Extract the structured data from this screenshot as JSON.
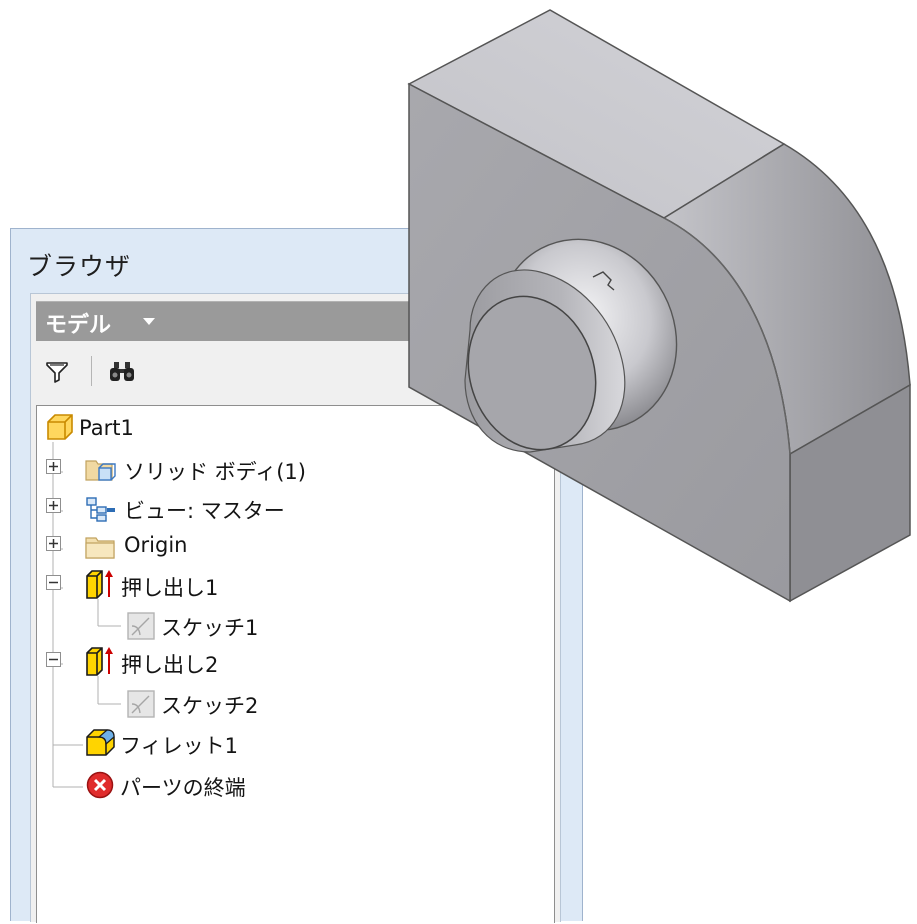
{
  "browser": {
    "title": "ブラウザ",
    "model_selector": {
      "label": "モデル"
    },
    "toolbar": {
      "filter_icon": "filter-icon",
      "find_icon": "binoculars-icon"
    },
    "tree": [
      {
        "label": "Part1",
        "icon": "part-icon",
        "expander": "none"
      },
      {
        "label": "ソリッド ボディ(1)",
        "icon": "solid-bodies-folder-icon",
        "expander": "plus"
      },
      {
        "label": "ビュー: マスター",
        "icon": "view-rep-icon",
        "expander": "plus"
      },
      {
        "label": "Origin",
        "icon": "folder-icon",
        "expander": "plus"
      },
      {
        "label": "押し出し1",
        "icon": "extrude-icon",
        "expander": "minus"
      },
      {
        "label": "スケッチ1",
        "icon": "sketch-icon",
        "expander": "none"
      },
      {
        "label": "押し出し2",
        "icon": "extrude-icon",
        "expander": "minus"
      },
      {
        "label": "スケッチ2",
        "icon": "sketch-icon",
        "expander": "none"
      },
      {
        "label": "フィレット1",
        "icon": "fillet-icon",
        "expander": "none"
      },
      {
        "label": "パーツの終端",
        "icon": "end-of-part-icon",
        "expander": "none"
      }
    ]
  },
  "colors": {
    "panel_bg": "#dde9f6",
    "header_bar": "#9a9a9a",
    "model_face_front": "#a3a3a7",
    "model_face_top": "#cacacf",
    "model_face_side": "#8d8d91"
  }
}
